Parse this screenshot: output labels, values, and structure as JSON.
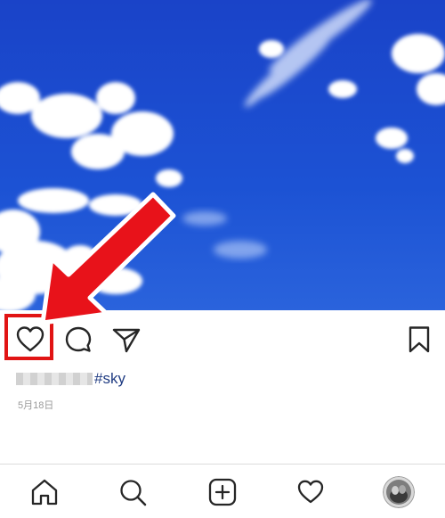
{
  "post": {
    "caption_hashtag": "#sky",
    "date": "5月18日"
  },
  "icons": {
    "like": "heart-outline-icon",
    "comment": "comment-bubble-icon",
    "share": "paper-plane-icon",
    "save": "bookmark-icon",
    "home": "home-icon",
    "search": "search-icon",
    "add": "add-post-icon",
    "activity": "heart-outline-icon",
    "profile": "avatar"
  },
  "colors": {
    "highlight": "#e11414",
    "hashtag": "#1f3b82",
    "sky": "#1b4ed0"
  }
}
